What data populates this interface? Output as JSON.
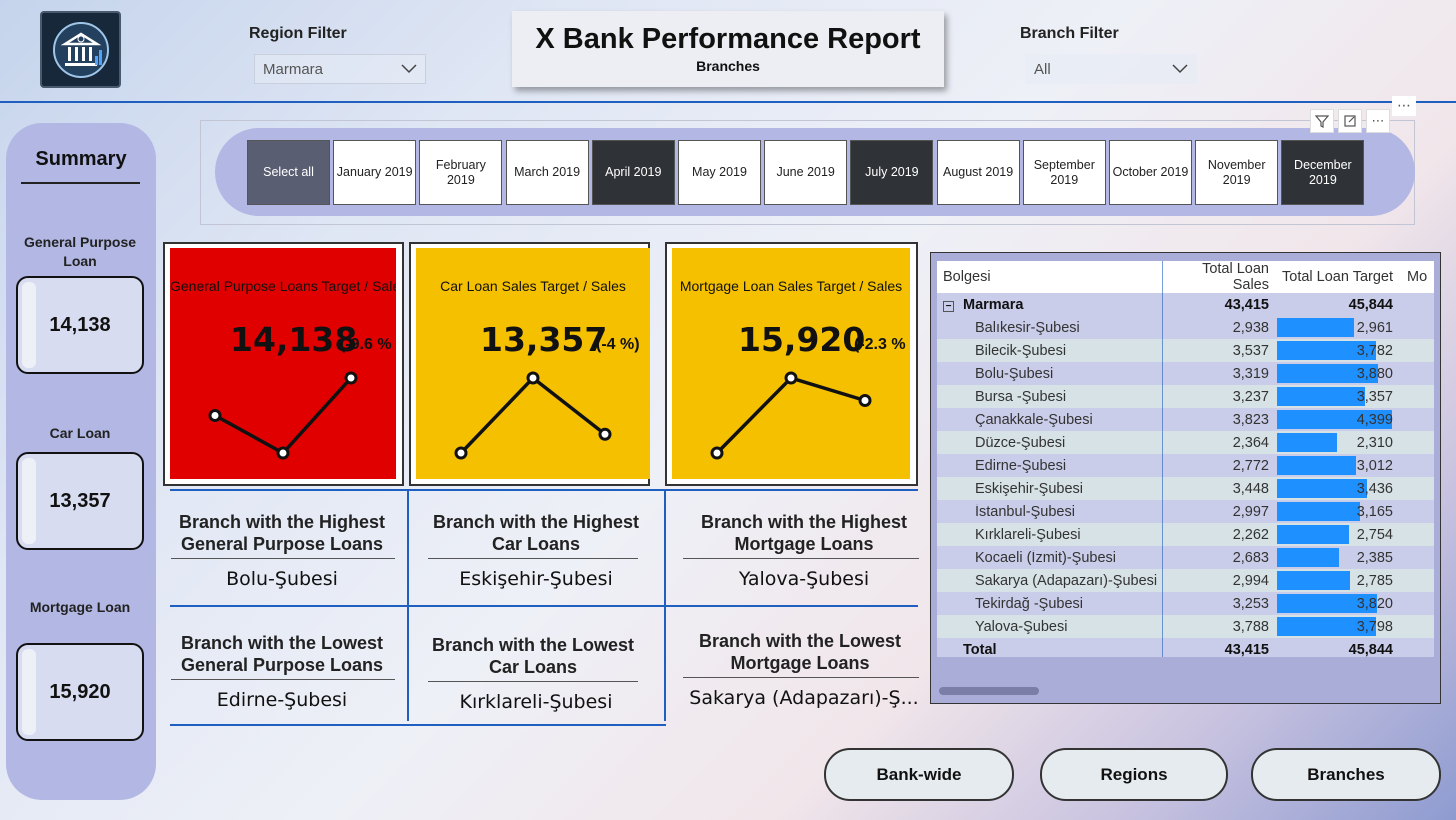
{
  "header": {
    "title": "X Bank Performance Report",
    "subtitle": "Branches",
    "region_filter": {
      "label": "Region Filter",
      "value": "Marmara"
    },
    "branch_filter": {
      "label": "Branch Filter",
      "value": "All"
    },
    "logo_icon": "bank-icon"
  },
  "sidebar": {
    "title": "Summary",
    "items": [
      {
        "label": "General Purpose Loan",
        "value": "14,138"
      },
      {
        "label": "Car Loan",
        "value": "13,357"
      },
      {
        "label": "Mortgage Loan",
        "value": "15,920"
      }
    ]
  },
  "months": [
    {
      "label": "Select all",
      "selected": false
    },
    {
      "label": "January 2019",
      "selected": false
    },
    {
      "label": "February 2019",
      "selected": false
    },
    {
      "label": "March 2019",
      "selected": false
    },
    {
      "label": "April 2019",
      "selected": true
    },
    {
      "label": "May 2019",
      "selected": false
    },
    {
      "label": "June 2019",
      "selected": false
    },
    {
      "label": "July 2019",
      "selected": true
    },
    {
      "label": "August 2019",
      "selected": false
    },
    {
      "label": "September 2019",
      "selected": false
    },
    {
      "label": "October 2019",
      "selected": false
    },
    {
      "label": "November 2019",
      "selected": false
    },
    {
      "label": "December 2019",
      "selected": true
    }
  ],
  "kpis": [
    {
      "title": "General Purpose Loans Target / Sales",
      "value": "14,138",
      "pct": "(-9.6 %",
      "color": "#e00000",
      "trend": [
        3,
        1,
        5
      ]
    },
    {
      "title": "Car Loan Sales Target / Sales",
      "value": "13,357",
      "pct": "(-4 %)",
      "color": "#f5c000",
      "trend": [
        1,
        5,
        2
      ]
    },
    {
      "title": "Mortgage Loan Sales Target / Sales",
      "value": "15,920",
      "pct": "(-2.3 %",
      "color": "#f5c000",
      "trend": [
        1,
        5,
        3.8
      ]
    }
  ],
  "highlights": {
    "highest": [
      {
        "title": "Branch with the Highest General Purpose Loans",
        "value": "Bolu-Şubesi"
      },
      {
        "title": "Branch with the Highest Car Loans",
        "value": "Eskişehir-Şubesi"
      },
      {
        "title": "Branch with the Highest Mortgage Loans",
        "value": "Yalova-Şubesi"
      }
    ],
    "lowest": [
      {
        "title": "Branch with the Lowest General Purpose Loans",
        "value": "Edirne-Şubesi"
      },
      {
        "title": "Branch with the Lowest Car Loans",
        "value": "Kırklareli-Şubesi"
      },
      {
        "title": "Branch with the Lowest Mortgage Loans",
        "value": "Sakarya (Adapazarı)-Ş..."
      }
    ]
  },
  "table": {
    "columns": [
      "Bolgesi",
      "Total Loan Sales",
      "Total Loan Target",
      "Mo"
    ],
    "group": {
      "name": "Marmara",
      "sales": "43,415",
      "target": "45,844",
      "expand_icon": "collapse-icon"
    },
    "rows": [
      {
        "name": "Balıkesir-Şubesi",
        "sales": "2,938",
        "target": "2,961",
        "target_num": 2961
      },
      {
        "name": "Bilecik-Şubesi",
        "sales": "3,537",
        "target": "3,782",
        "target_num": 3782
      },
      {
        "name": "Bolu-Şubesi",
        "sales": "3,319",
        "target": "3,880",
        "target_num": 3880
      },
      {
        "name": "Bursa -Şubesi",
        "sales": "3,237",
        "target": "3,357",
        "target_num": 3357
      },
      {
        "name": "Çanakkale-Şubesi",
        "sales": "3,823",
        "target": "4,399",
        "target_num": 4399
      },
      {
        "name": "Düzce-Şubesi",
        "sales": "2,364",
        "target": "2,310",
        "target_num": 2310
      },
      {
        "name": "Edirne-Şubesi",
        "sales": "2,772",
        "target": "3,012",
        "target_num": 3012
      },
      {
        "name": "Eskişehir-Şubesi",
        "sales": "3,448",
        "target": "3,436",
        "target_num": 3436
      },
      {
        "name": "İstanbul-Şubesi",
        "sales": "2,997",
        "target": "3,165",
        "target_num": 3165
      },
      {
        "name": "Kırklareli-Şubesi",
        "sales": "2,262",
        "target": "2,754",
        "target_num": 2754
      },
      {
        "name": "Kocaeli (İzmit)-Şubesi",
        "sales": "2,683",
        "target": "2,385",
        "target_num": 2385
      },
      {
        "name": "Sakarya (Adapazarı)-Şubesi",
        "sales": "2,994",
        "target": "2,785",
        "target_num": 2785
      },
      {
        "name": "Tekirdağ -Şubesi",
        "sales": "3,253",
        "target": "3,820",
        "target_num": 3820
      },
      {
        "name": "Yalova-Şubesi",
        "sales": "3,788",
        "target": "3,798",
        "target_num": 3798
      }
    ],
    "total": {
      "name": "Total",
      "sales": "43,415",
      "target": "45,844"
    },
    "bar_color": "#1e90ff"
  },
  "nav": {
    "bankwide": "Bank-wide",
    "regions": "Regions",
    "branches": "Branches"
  }
}
